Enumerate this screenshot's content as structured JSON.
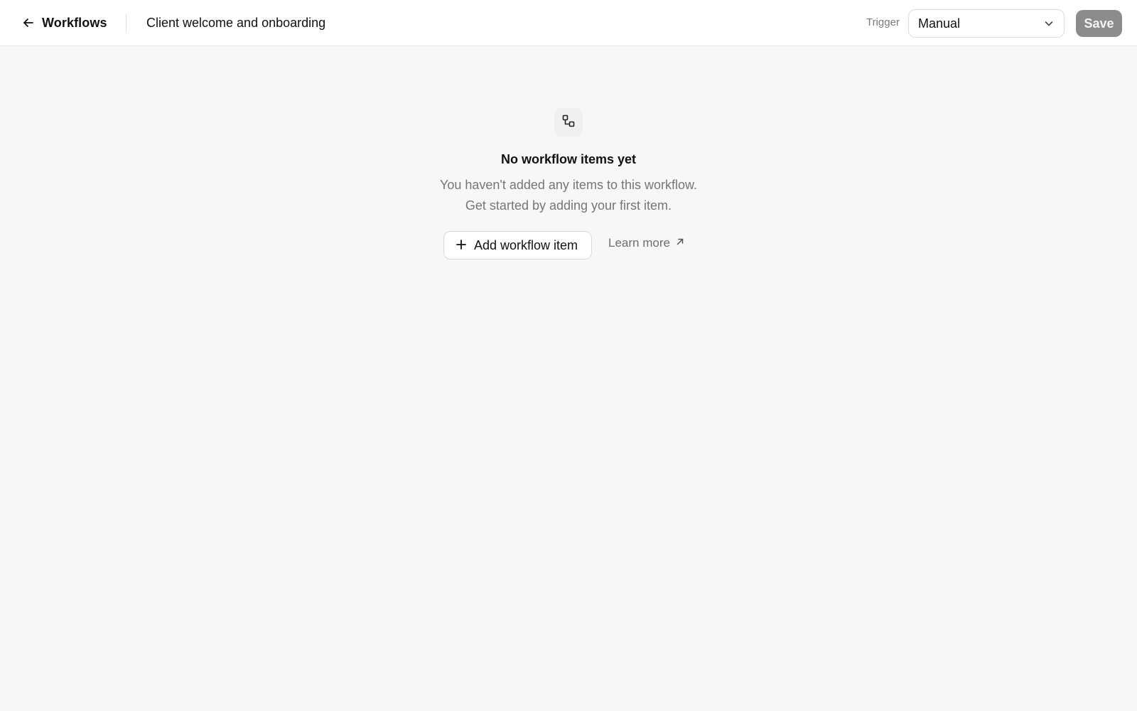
{
  "header": {
    "back_label": "Workflows",
    "back_icon": "arrow-left-icon",
    "title": "Client welcome and onboarding",
    "trigger_label": "Trigger",
    "trigger_value": "Manual",
    "trigger_icon": "chevron-down-icon",
    "save_label": "Save"
  },
  "empty_state": {
    "icon": "workflow-icon",
    "title": "No workflow items yet",
    "description_line1": "You haven't added any items to this workflow.",
    "description_line2": "Get started by adding your first item.",
    "add_label": "Add workflow item",
    "add_icon": "plus-icon",
    "learn_more_label": "Learn more",
    "learn_more_icon": "arrow-up-right-icon"
  },
  "colors": {
    "background": "#f7f7f7",
    "header_background": "#ffffff",
    "save_button": "#8c8c8c",
    "muted_text": "#767676"
  }
}
